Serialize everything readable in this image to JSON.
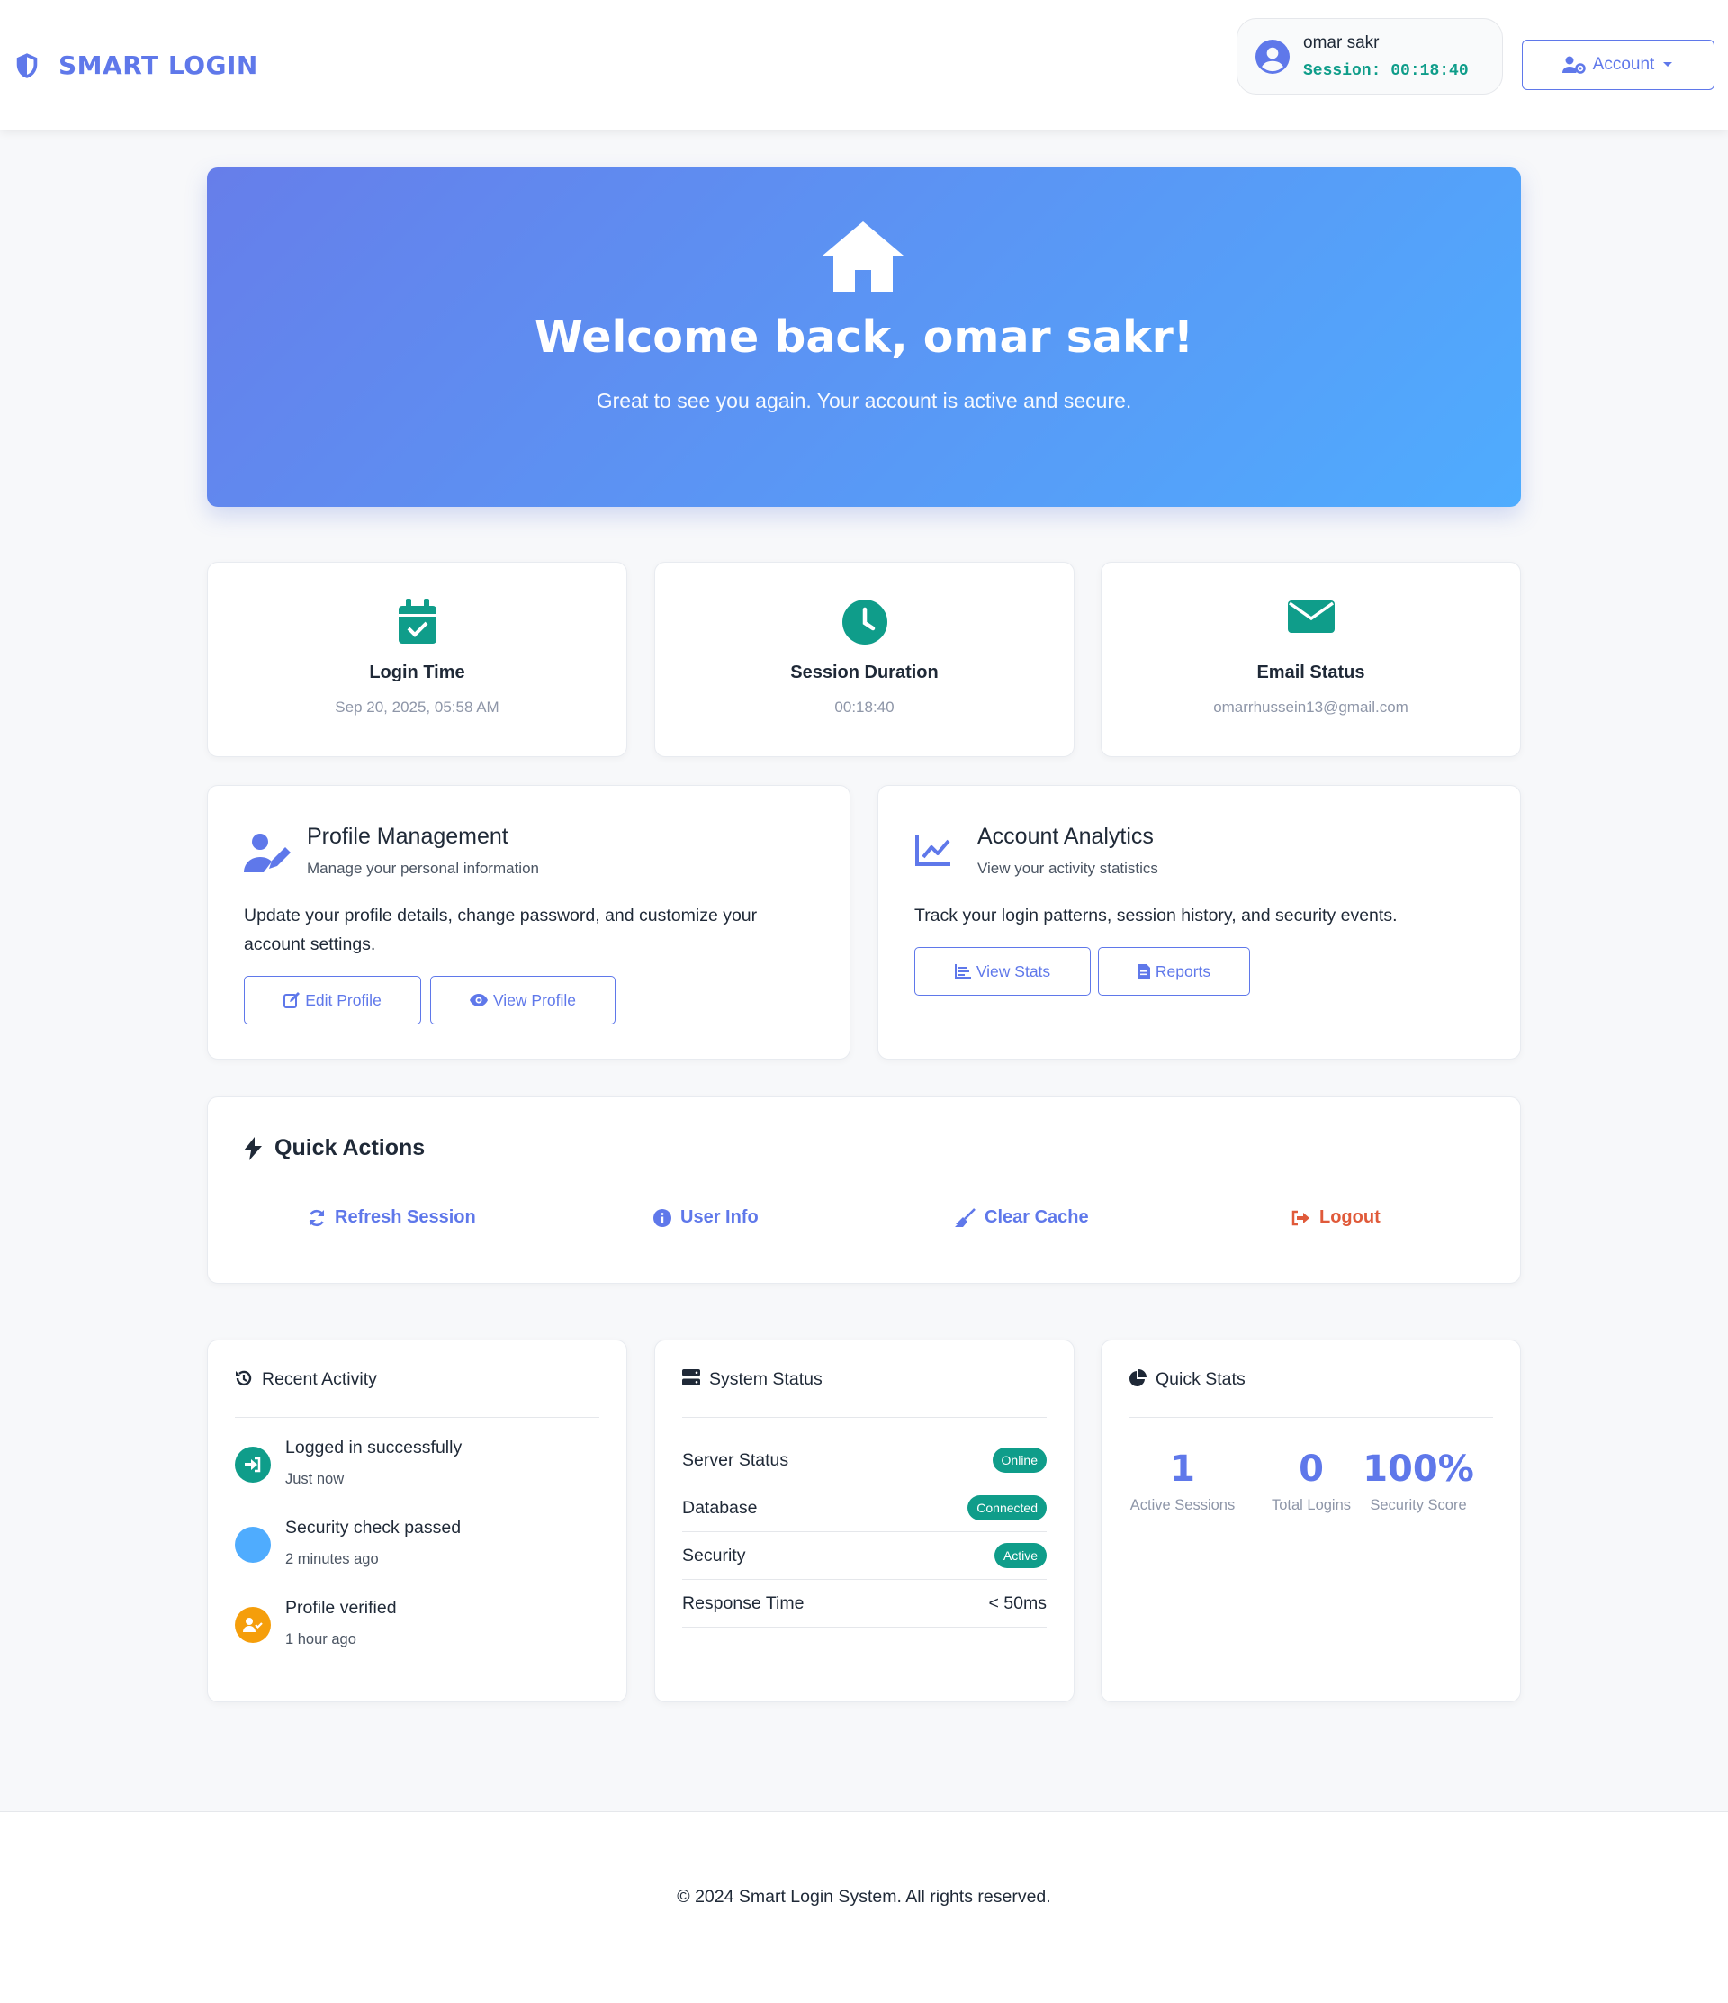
{
  "nav": {
    "brand": "SMART LOGIN",
    "user_name": "omar sakr",
    "session_label": "Session:",
    "session_time": "00:18:40",
    "account_label": "Account"
  },
  "hero": {
    "title": "Welcome back, omar sakr!",
    "subtitle": "Great to see you again. Your account is active and secure."
  },
  "stats": [
    {
      "title": "Login Time",
      "value": "Sep 20, 2025, 05:58 AM",
      "icon": "calendar-check-icon"
    },
    {
      "title": "Session Duration",
      "value": "00:18:40",
      "icon": "clock-icon"
    },
    {
      "title": "Email Status",
      "value": "omarrhussein13@gmail.com",
      "icon": "envelope-icon"
    }
  ],
  "profile": {
    "title": "Profile Management",
    "subtitle": "Manage your personal information",
    "description_line1": "Update your profile details, change password, and customize your",
    "description_line2": "account settings.",
    "edit_label": "Edit Profile",
    "view_label": "View Profile"
  },
  "analytics": {
    "title": "Account Analytics",
    "subtitle": "View your activity statistics",
    "description": "Track your login patterns, session history, and security events.",
    "stats_label": "View Stats",
    "reports_label": "Reports"
  },
  "quick_actions": {
    "title": "Quick Actions",
    "refresh": "Refresh Session",
    "user_info": "User Info",
    "clear_cache": "Clear Cache",
    "logout": "Logout"
  },
  "recent_activity": {
    "title": "Recent Activity",
    "items": [
      {
        "text": "Logged in successfully",
        "time": "Just now",
        "color": "#0f9d8a"
      },
      {
        "text": "Security check passed",
        "time": "2 minutes ago",
        "color": "#4facfe"
      },
      {
        "text": "Profile verified",
        "time": "1 hour ago",
        "color": "#f59e0b"
      }
    ]
  },
  "system_status": {
    "title": "System Status",
    "rows": [
      {
        "label": "Server Status",
        "value": "Online"
      },
      {
        "label": "Database",
        "value": "Connected"
      },
      {
        "label": "Security",
        "value": "Active"
      },
      {
        "label": "Response Time",
        "value": "< 50ms"
      }
    ]
  },
  "quick_stats": {
    "title": "Quick Stats",
    "items": [
      {
        "number": "1",
        "label": "Active Sessions"
      },
      {
        "number": "0",
        "label": "Total Logins"
      },
      {
        "number": "100%",
        "label": "Security Score"
      }
    ]
  },
  "footer": {
    "text": "© 2024 Smart Login System. All rights reserved."
  },
  "colors": {
    "accent": "#5f78ea",
    "teal": "#0f9d8a",
    "danger": "#e05a3a",
    "hero_start": "#667eea",
    "hero_end": "#4facfe"
  }
}
